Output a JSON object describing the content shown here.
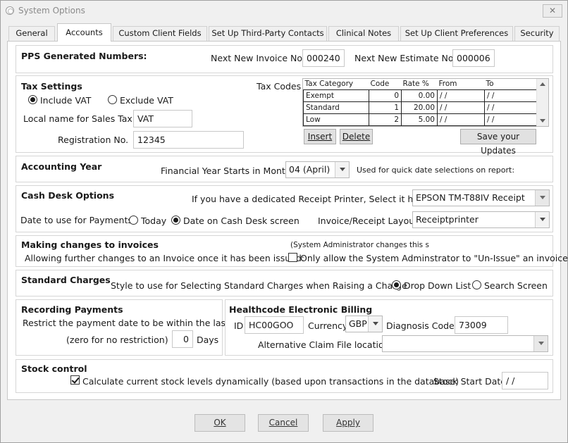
{
  "window": {
    "title": "System Options",
    "close_glyph": "✕"
  },
  "tabs": [
    "General",
    "Accounts",
    "Custom Client Fields",
    "Set Up Third-Party Contacts",
    "Clinical Notes",
    "Set Up Client Preferences",
    "Security"
  ],
  "active_tab": "Accounts",
  "pps": {
    "heading": "PPS Generated Numbers:",
    "next_invoice_label": "Next New Invoice No.",
    "next_invoice_value": "000240",
    "next_estimate_label": "Next New Estimate No.",
    "next_estimate_value": "000006"
  },
  "tax": {
    "heading": "Tax Settings",
    "include_vat": "Include VAT",
    "exclude_vat": "Exclude VAT",
    "local_name_label": "Local name for Sales Tax",
    "local_name_value": "VAT",
    "registration_label": "Registration No.",
    "registration_value": "12345",
    "codes_label": "Tax Codes",
    "columns": [
      "Tax Category",
      "Code",
      "Rate %",
      "From",
      "To"
    ],
    "rows": [
      {
        "category": "Exempt",
        "code": "0",
        "rate": "0.00",
        "from": " /  /",
        "to": " /  /"
      },
      {
        "category": "Standard",
        "code": "1",
        "rate": "20.00",
        "from": " /  /",
        "to": " /  /"
      },
      {
        "category": "Low",
        "code": "2",
        "rate": "5.00",
        "from": " /  /",
        "to": " /  /"
      }
    ],
    "insert_label": "Insert",
    "delete_label": "Delete",
    "save_label": "Save your Updates"
  },
  "accounting_year": {
    "heading": "Accounting Year",
    "starts_label": "Financial Year Starts in Month",
    "month_value": "04 (April)",
    "note": "Used for quick date selections on report:"
  },
  "cash_desk": {
    "heading": "Cash Desk Options",
    "printer_label": "If you have a dedicated Receipt Printer, Select it here:",
    "printer_value": "EPSON TM-T88IV Receipt",
    "date_label": "Date to use for Payments",
    "today_label": "Today",
    "cash_desk_date_label": "Date on Cash Desk screen",
    "layout_label": "Invoice/Receipt Layout",
    "layout_value": "Receiptprinter"
  },
  "invoice_changes": {
    "heading": "Making changes to invoices",
    "admin_note": "(System Administrator changes this s",
    "allow_label": "Allowing further changes to an Invoice once it has been issued:",
    "only_admin_label": "Only allow the System Adminstrator to \"Un-Issue\" an invoice"
  },
  "standard_charges": {
    "heading": "Standard Charges",
    "style_label": "Style to use for Selecting Standard Charges when Raising a Charge",
    "drop_down_label": "Drop Down List",
    "search_screen_label": "Search Screen"
  },
  "recording_payments": {
    "heading": "Recording Payments",
    "restrict_label": "Restrict the payment date to be within the last",
    "zero_label": "(zero for no restriction)",
    "days_value": "0",
    "days_label": "Days"
  },
  "healthcode": {
    "heading": "Healthcode Electronic Billing",
    "id_label": "ID",
    "id_value": "HC00GOO",
    "currency_label": "Currency",
    "currency_value": "GBP",
    "diagnosis_label": "Diagnosis Code",
    "diagnosis_value": "73009",
    "alt_claim_label": "Alternative Claim File location",
    "alt_claim_value": ""
  },
  "stock": {
    "heading": "Stock control",
    "calc_label": "Calculate current stock levels dynamically (based upon transactions in the database)",
    "start_date_label": "Stock Start Date",
    "start_date_value": " /  /"
  },
  "buttons": {
    "ok": "OK",
    "cancel": "Cancel",
    "apply": "Apply"
  }
}
